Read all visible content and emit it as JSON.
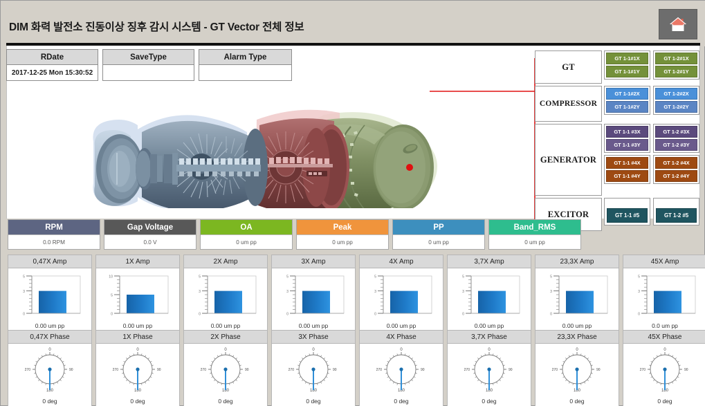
{
  "header": {
    "title": "DIM  화력 발전소 진동이상 징후 감시 시스템 - GT Vector 전체 정보",
    "home_icon": "home-icon"
  },
  "info_table": {
    "columns": [
      {
        "header": "RDate",
        "value": "2017-12-25 Mon 15:30:52"
      },
      {
        "header": "SaveType",
        "value": ""
      },
      {
        "header": "Alarm Type",
        "value": ""
      }
    ]
  },
  "equipment_tree": {
    "groups": [
      {
        "label": "GT",
        "pairs": [
          {
            "color": "#74913a",
            "tags": [
              "GT 1-1#1X",
              "GT 1-1#1Y"
            ]
          },
          {
            "color": "#74913a",
            "tags": [
              "GT 1-2#1X",
              "GT 1-2#1Y"
            ]
          }
        ]
      },
      {
        "label": "COMPRESSOR",
        "pairs": [
          {
            "color": "#4a90d9",
            "tags": [
              "GT 1-1#2X",
              "GT 1-1#2Y"
            ]
          },
          {
            "color": "#4a90d9",
            "tags": [
              "GT 1-2#2X",
              "GT 1-2#2Y"
            ]
          }
        ]
      },
      {
        "label": "GENERATOR",
        "pairs": [
          {
            "color": "#5b4a7d",
            "tags": [
              "GT 1-1 #3X",
              "GT 1-1 #3Y"
            ]
          },
          {
            "color": "#5b4a7d",
            "tags": [
              "GT 1-2 #3X",
              "GT 1-2 #3Y"
            ]
          },
          {
            "color": "#9e4a12",
            "tags": [
              "GT 1-1 #4X",
              "GT 1-1 #4Y"
            ]
          },
          {
            "color": "#9e4a12",
            "tags": [
              "GT 1-2 #4X",
              "GT 1-2 #4Y"
            ]
          }
        ]
      },
      {
        "label": "EXCITOR",
        "pairs": [
          {
            "color": "#1f5560",
            "tags": [
              "GT 1-1 #5"
            ]
          },
          {
            "color": "#1f5560",
            "tags": [
              "GT 1-2 #5"
            ]
          }
        ]
      }
    ]
  },
  "metrics": [
    {
      "label": "RPM",
      "value": "0.0 RPM",
      "color": "#5d6582"
    },
    {
      "label": "Gap Voltage",
      "value": "0.0 V",
      "color": "#585858"
    },
    {
      "label": "OA",
      "value": "0 um pp",
      "color": "#7cb721"
    },
    {
      "label": "Peak",
      "value": "0 um pp",
      "color": "#f0943c"
    },
    {
      "label": "PP",
      "value": "0 um pp",
      "color": "#3d8fbe"
    },
    {
      "label": "Band_RMS",
      "value": "0 um pp",
      "color": "#2ebd8e"
    }
  ],
  "chart_data": [
    {
      "type": "bar",
      "title": "0,47X Amp",
      "categories": [
        ""
      ],
      "values": [
        3
      ],
      "ylim": [
        0,
        5
      ],
      "ylabel": "",
      "xlabel": "",
      "value_label": "0.00 um pp",
      "ticks": [
        "0",
        "3",
        "5"
      ]
    },
    {
      "type": "bar",
      "title": "1X Amp",
      "categories": [
        ""
      ],
      "values": [
        5
      ],
      "ylim": [
        0,
        10
      ],
      "ylabel": "",
      "xlabel": "",
      "value_label": "0.00 um pp",
      "ticks": [
        "0",
        "5",
        "10"
      ]
    },
    {
      "type": "bar",
      "title": "2X Amp",
      "categories": [
        ""
      ],
      "values": [
        3
      ],
      "ylim": [
        0,
        5
      ],
      "ylabel": "",
      "xlabel": "",
      "value_label": "0.00 um pp",
      "ticks": [
        "0",
        "3",
        "5"
      ]
    },
    {
      "type": "bar",
      "title": "3X Amp",
      "categories": [
        ""
      ],
      "values": [
        3
      ],
      "ylim": [
        0,
        5
      ],
      "ylabel": "",
      "xlabel": "",
      "value_label": "0.00 um pp",
      "ticks": [
        "0",
        "3",
        "5"
      ]
    },
    {
      "type": "bar",
      "title": "4X Amp",
      "categories": [
        ""
      ],
      "values": [
        3
      ],
      "ylim": [
        0,
        5
      ],
      "ylabel": "",
      "xlabel": "",
      "value_label": "0.00 um pp",
      "ticks": [
        "0",
        "3",
        "5"
      ]
    },
    {
      "type": "bar",
      "title": "3,7X Amp",
      "categories": [
        ""
      ],
      "values": [
        3
      ],
      "ylim": [
        0,
        5
      ],
      "ylabel": "",
      "xlabel": "",
      "value_label": "0.00 um pp",
      "ticks": [
        "0",
        "3",
        "5"
      ]
    },
    {
      "type": "bar",
      "title": "23,3X Amp",
      "categories": [
        ""
      ],
      "values": [
        3
      ],
      "ylim": [
        0,
        5
      ],
      "ylabel": "",
      "xlabel": "",
      "value_label": "0.00 um pp",
      "ticks": [
        "0",
        "3",
        "5"
      ]
    },
    {
      "type": "bar",
      "title": "45X Amp",
      "categories": [
        ""
      ],
      "values": [
        3
      ],
      "ylim": [
        0,
        5
      ],
      "ylabel": "",
      "xlabel": "",
      "value_label": "0.0 um pp",
      "ticks": [
        "0",
        "3",
        "5"
      ]
    },
    {
      "type": "gauge",
      "title": "0,47X Phase",
      "value": 0,
      "unit": "deg",
      "value_label": "0 deg",
      "range": [
        0,
        360
      ],
      "dial_labels": {
        "top": "0",
        "right": "90",
        "bottom": "180",
        "left": "270"
      }
    },
    {
      "type": "gauge",
      "title": "1X Phase",
      "value": 0,
      "unit": "deg",
      "value_label": "0 deg",
      "range": [
        0,
        360
      ],
      "dial_labels": {
        "top": "0",
        "right": "90",
        "bottom": "180",
        "left": "270"
      }
    },
    {
      "type": "gauge",
      "title": "2X Phase",
      "value": 0,
      "unit": "deg",
      "value_label": "0 deg",
      "range": [
        0,
        360
      ],
      "dial_labels": {
        "top": "0",
        "right": "90",
        "bottom": "180",
        "left": "270"
      }
    },
    {
      "type": "gauge",
      "title": "3X Phase",
      "value": 0,
      "unit": "deg",
      "value_label": "0 deg",
      "range": [
        0,
        360
      ],
      "dial_labels": {
        "top": "0",
        "right": "90",
        "bottom": "180",
        "left": "270"
      }
    },
    {
      "type": "gauge",
      "title": "4X Phase",
      "value": 0,
      "unit": "deg",
      "value_label": "0 deg",
      "range": [
        0,
        360
      ],
      "dial_labels": {
        "top": "0",
        "right": "90",
        "bottom": "180",
        "left": "270"
      }
    },
    {
      "type": "gauge",
      "title": "3,7X Phase",
      "value": 0,
      "unit": "deg",
      "value_label": "0 deg",
      "range": [
        0,
        360
      ],
      "dial_labels": {
        "top": "0",
        "right": "90",
        "bottom": "180",
        "left": "270"
      }
    },
    {
      "type": "gauge",
      "title": "23,3X Phase",
      "value": 0,
      "unit": "deg",
      "value_label": "0 deg",
      "range": [
        0,
        360
      ],
      "dial_labels": {
        "top": "0",
        "right": "90",
        "bottom": "180",
        "left": "270"
      }
    },
    {
      "type": "gauge",
      "title": "45X Phase",
      "value": 0,
      "unit": "deg",
      "value_label": "0 deg",
      "range": [
        0,
        360
      ],
      "dial_labels": {
        "top": "0",
        "right": "90",
        "bottom": "180",
        "left": "270"
      }
    }
  ],
  "diagram": {
    "name": "gas-turbine-cutaway",
    "sections": [
      {
        "name": "compressor-section",
        "color": "#7d93a8"
      },
      {
        "name": "turbine-section",
        "color": "#8e4b4b"
      },
      {
        "name": "exhaust-section",
        "color": "#7d8f62"
      }
    ],
    "connector_color": "#e01010"
  }
}
